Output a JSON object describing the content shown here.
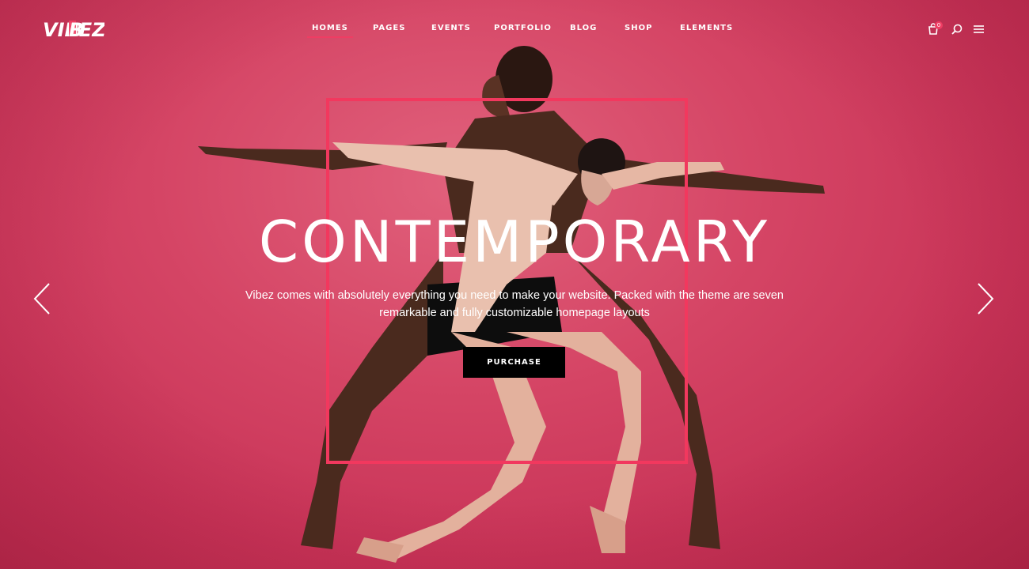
{
  "logo": {
    "text": "VIBEZ"
  },
  "nav": {
    "items": [
      {
        "label": "HOMES",
        "active": true
      },
      {
        "label": "PAGES",
        "active": false
      },
      {
        "label": "EVENTS",
        "active": false
      },
      {
        "label": "PORTFOLIO",
        "active": false
      },
      {
        "label": "BLOG",
        "active": false
      },
      {
        "label": "SHOP",
        "active": false
      },
      {
        "label": "ELEMENTS",
        "active": false
      }
    ]
  },
  "header_actions": {
    "cart_count": "0",
    "icons": [
      "cart-icon",
      "search-icon",
      "menu-icon"
    ]
  },
  "hero": {
    "title": "CONTEMPORARY",
    "description_line1": "Vibez comes with absolutely everything you need to make your website. Packed with the theme are seven",
    "description_line2": "remarkable and fully customizable homepage layouts",
    "button_label": "PURCHASE"
  },
  "slider": {
    "prev_icon": "chevron-left-icon",
    "next_icon": "chevron-right-icon"
  },
  "colors": {
    "background": "#d54565",
    "accent": "#f2385e",
    "button": "#000000",
    "text": "#ffffff"
  }
}
